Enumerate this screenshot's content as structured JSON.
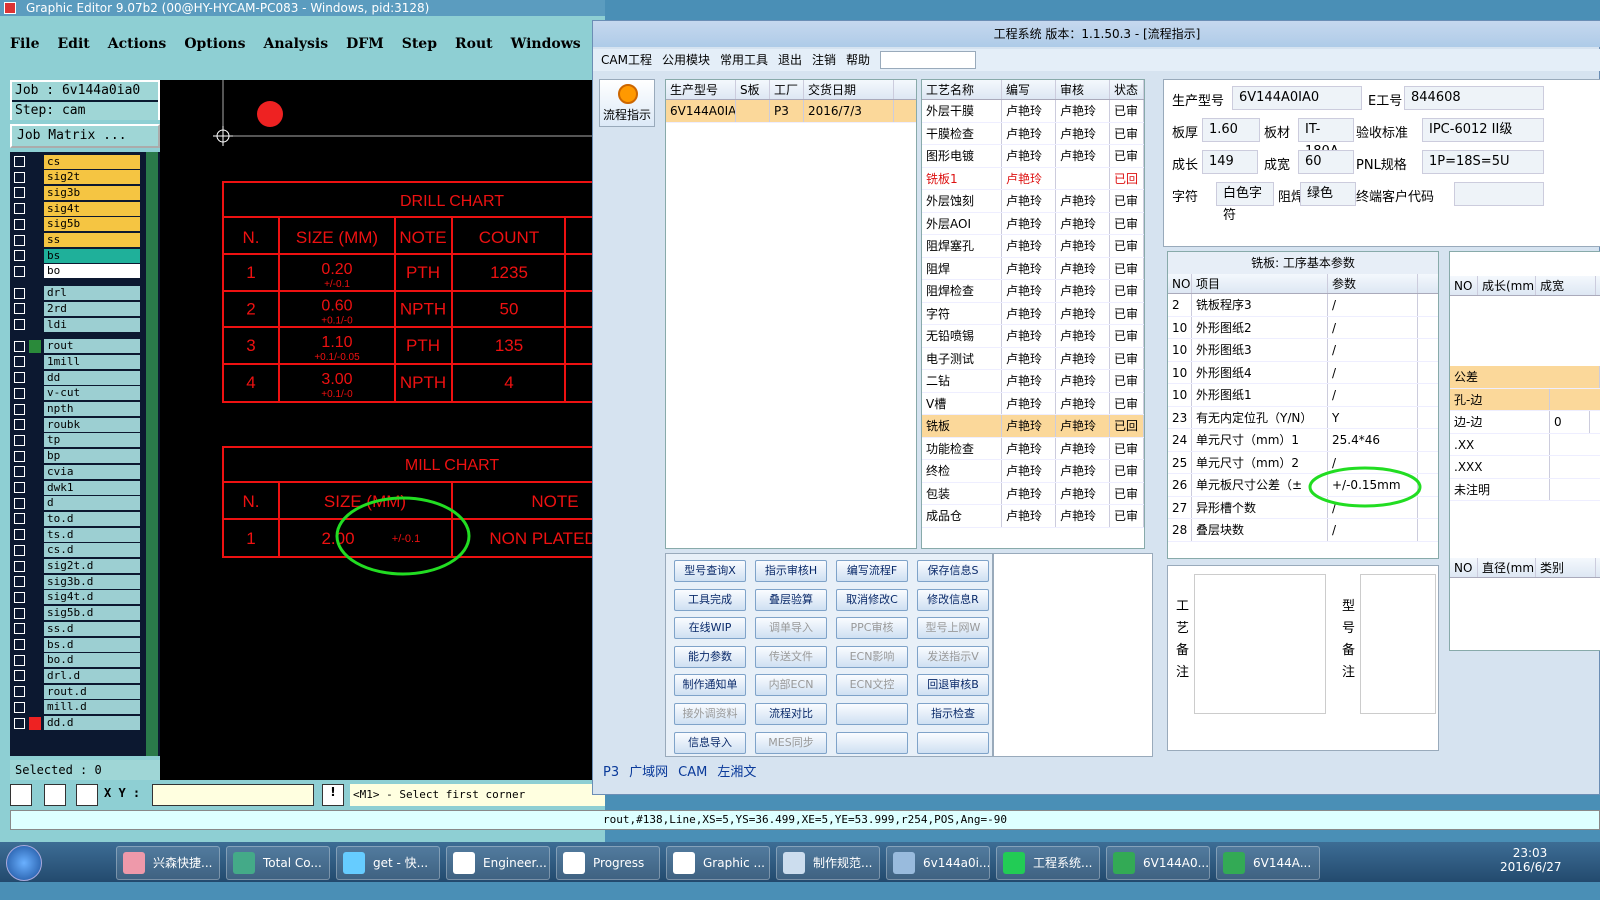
{
  "left_window": {
    "title": "Graphic Editor 9.07b2 (00@HY-HYCAM-PC083 - Windows, pid:3128)",
    "menu": [
      "File",
      "Edit",
      "Actions",
      "Options",
      "Analysis",
      "DFM",
      "Step",
      "Rout",
      "Windows"
    ],
    "job": "Job : 6v144a0ia0",
    "step": "Step: cam",
    "job_matrix": "Job Matrix ...",
    "selected": "Selected : 0",
    "xy_label": "X Y :",
    "prompt": "<M1> - Select first corner",
    "status": "rout,#138,Line,XS=5,YS=36.499,XE=5,YE=53.999,r254,POS,Ang=-90",
    "layers": [
      {
        "name": "cs",
        "color": "#f5c542"
      },
      {
        "name": "sig2t",
        "color": "#f5c542"
      },
      {
        "name": "sig3b",
        "color": "#f5c542"
      },
      {
        "name": "sig4t",
        "color": "#f5c542"
      },
      {
        "name": "sig5b",
        "color": "#f5c542"
      },
      {
        "name": "ss",
        "color": "#f5c542"
      },
      {
        "name": "bs",
        "color": "#1fb09a"
      },
      {
        "name": "bo",
        "color": "#ffffff"
      },
      {
        "name": "drl",
        "color": "#9ccfd2"
      },
      {
        "name": "2rd",
        "color": "#9ccfd2"
      },
      {
        "name": "ldi",
        "color": "#9ccfd2"
      },
      {
        "name": "rout",
        "color": "#9ccfd2"
      },
      {
        "name": "1mill",
        "color": "#9ccfd2"
      },
      {
        "name": "dd",
        "color": "#9ccfd2"
      },
      {
        "name": "v-cut",
        "color": "#9ccfd2"
      },
      {
        "name": "npth",
        "color": "#9ccfd2"
      },
      {
        "name": "roubk",
        "color": "#9ccfd2"
      },
      {
        "name": "tp",
        "color": "#9ccfd2"
      },
      {
        "name": "bp",
        "color": "#9ccfd2"
      },
      {
        "name": "cvia",
        "color": "#9ccfd2"
      },
      {
        "name": "dwk1",
        "color": "#9ccfd2"
      },
      {
        "name": "d",
        "color": "#9ccfd2"
      },
      {
        "name": "to.d",
        "color": "#9ccfd2"
      },
      {
        "name": "ts.d",
        "color": "#9ccfd2"
      },
      {
        "name": "cs.d",
        "color": "#9ccfd2"
      },
      {
        "name": "sig2t.d",
        "color": "#9ccfd2"
      },
      {
        "name": "sig3b.d",
        "color": "#9ccfd2"
      },
      {
        "name": "sig4t.d",
        "color": "#9ccfd2"
      },
      {
        "name": "sig5b.d",
        "color": "#9ccfd2"
      },
      {
        "name": "ss.d",
        "color": "#9ccfd2"
      },
      {
        "name": "bs.d",
        "color": "#9ccfd2"
      },
      {
        "name": "bo.d",
        "color": "#9ccfd2"
      },
      {
        "name": "drl.d",
        "color": "#9ccfd2"
      },
      {
        "name": "rout.d",
        "color": "#9ccfd2"
      },
      {
        "name": "mill.d",
        "color": "#9ccfd2"
      },
      {
        "name": "dd.d",
        "color": "#9ccfd2"
      }
    ],
    "drill_chart": {
      "title": "DRILL CHART",
      "headers": [
        "N.",
        "SIZE (MM)",
        "NOTE",
        "COUNT"
      ],
      "rows": [
        [
          "1",
          "0.20",
          "+/-0.1",
          "PTH",
          "1235"
        ],
        [
          "2",
          "0.60",
          "+0.1/-0",
          "NPTH",
          "50"
        ],
        [
          "3",
          "1.10",
          "+0.1/-0.05",
          "PTH",
          "135"
        ],
        [
          "4",
          "3.00",
          "+0.1/-0",
          "NPTH",
          "4"
        ]
      ]
    },
    "mill_chart": {
      "title": "MILL CHART",
      "headers": [
        "N.",
        "SIZE (MM)",
        "NOTE"
      ],
      "rows": [
        [
          "1",
          "2.00",
          "+/-0.1",
          "NON PLATED"
        ]
      ]
    }
  },
  "right_window": {
    "title": "工程系统  版本：1.1.50.3 - [流程指示]",
    "menu": [
      "CAM工程",
      "公用模块",
      "常用工具",
      "退出",
      "注销",
      "帮助"
    ],
    "side_btn": "流程指示",
    "orders": {
      "headers": [
        "生产型号",
        "S板",
        "工厂",
        "交货日期"
      ],
      "row": [
        "6V144A0IA0",
        "",
        "P3",
        "2016/7/3"
      ]
    },
    "process": {
      "headers": [
        "工艺名称",
        "编写",
        "审核",
        "状态"
      ],
      "rows": [
        [
          "外层干膜",
          "卢艳玲",
          "卢艳玲",
          "已审"
        ],
        [
          "干膜检查",
          "卢艳玲",
          "卢艳玲",
          "已审"
        ],
        [
          "图形电镀",
          "卢艳玲",
          "卢艳玲",
          "已审"
        ],
        [
          "铣板1",
          "卢艳玲",
          "",
          "已回"
        ],
        [
          "外层蚀刻",
          "卢艳玲",
          "卢艳玲",
          "已审"
        ],
        [
          "外层AOI",
          "卢艳玲",
          "卢艳玲",
          "已审"
        ],
        [
          "阻焊塞孔",
          "卢艳玲",
          "卢艳玲",
          "已审"
        ],
        [
          "阻焊",
          "卢艳玲",
          "卢艳玲",
          "已审"
        ],
        [
          "阻焊检查",
          "卢艳玲",
          "卢艳玲",
          "已审"
        ],
        [
          "字符",
          "卢艳玲",
          "卢艳玲",
          "已审"
        ],
        [
          "无铅喷锡",
          "卢艳玲",
          "卢艳玲",
          "已审"
        ],
        [
          "电子测试",
          "卢艳玲",
          "卢艳玲",
          "已审"
        ],
        [
          "二钻",
          "卢艳玲",
          "卢艳玲",
          "已审"
        ],
        [
          "V槽",
          "卢艳玲",
          "卢艳玲",
          "已审"
        ],
        [
          "铣板",
          "卢艳玲",
          "卢艳玲",
          "已回"
        ],
        [
          "功能检查",
          "卢艳玲",
          "卢艳玲",
          "已审"
        ],
        [
          "终检",
          "卢艳玲",
          "卢艳玲",
          "已审"
        ],
        [
          "包装",
          "卢艳玲",
          "卢艳玲",
          "已审"
        ],
        [
          "成品仓",
          "卢艳玲",
          "卢艳玲",
          "已审"
        ]
      ]
    },
    "info": {
      "model_lbl": "生产型号",
      "model": "6V144A0IA0",
      "eno_lbl": "E工号",
      "eno": "844608",
      "thick_lbl": "板厚",
      "thick": "1.60",
      "mat_lbl": "板材",
      "mat": "IT-180A",
      "std_lbl": "验收标准",
      "std": "IPC-6012 II级",
      "len_lbl": "成长",
      "len": "149",
      "wid_lbl": "成宽",
      "wid": "60",
      "pnl_lbl": "PNL规格",
      "pnl": "1P=18S=5U",
      "char_lbl": "字符",
      "char": "白色字符",
      "mask_lbl": "阻焊",
      "mask": "绿色",
      "cust_lbl": "终端客户代码",
      "cust": ""
    },
    "params": {
      "title": "铣板: 工序基本参数",
      "headers": [
        "NO",
        "项目",
        "参数"
      ],
      "rows": [
        [
          "2",
          "铣板程序3",
          "/"
        ],
        [
          "10",
          "外形图纸2",
          "/"
        ],
        [
          "10",
          "外形图纸3",
          "/"
        ],
        [
          "10",
          "外形图纸4",
          "/"
        ],
        [
          "10",
          "外形图纸1",
          "/"
        ],
        [
          "23",
          "有无内定位孔（Y/N）",
          "Y"
        ],
        [
          "24",
          "单元尺寸（mm）1",
          "25.4*46"
        ],
        [
          "25",
          "单元尺寸（mm）2",
          "/"
        ],
        [
          "26",
          "单元板尺寸公差（±",
          "+/-0.15mm"
        ],
        [
          "27",
          "异形槽个数",
          "/"
        ],
        [
          "28",
          "叠层块数",
          "/"
        ]
      ]
    },
    "tol": {
      "headers": [
        "NO",
        "成长(mm)",
        "成宽"
      ],
      "label": "公差",
      "rows": [
        "孔-边",
        "边-边",
        ".XX",
        ".XXX",
        "未注明"
      ],
      "edge_val": "0",
      "h2": [
        "NO",
        "直径(mm)",
        "类别"
      ]
    },
    "buttons": [
      [
        "型号查询X",
        "指示审核H",
        "编写流程F",
        "保存信息S"
      ],
      [
        "工具完成",
        "叠层验算",
        "取消修改C",
        "修改信息R"
      ],
      [
        "在线WIP",
        "调单导入",
        "PPC审核",
        "型号上网W"
      ],
      [
        "能力参数",
        "传送文件",
        "ECN影响",
        "发送指示V"
      ],
      [
        "制作通知单",
        "内部ECN",
        "ECN文控",
        "回退审核B"
      ],
      [
        "接外调资料",
        "流程对比",
        "",
        "指示检查"
      ],
      [
        "信息导入",
        "MES同步",
        "",
        ""
      ]
    ],
    "remark1": "工艺备注",
    "remark2": "型号备注",
    "tabs": [
      "P3",
      "广域网",
      "CAM",
      "左湘文"
    ]
  },
  "taskbar": {
    "items": [
      "兴森快捷...",
      "Total Co...",
      "get - 快...",
      "Engineer...",
      "Progress",
      "Graphic ...",
      "制作规范...",
      "6v144a0i...",
      "工程系统...",
      "6V144A0...",
      "6V144A..."
    ],
    "time": "23:03",
    "date": "2016/6/27"
  }
}
